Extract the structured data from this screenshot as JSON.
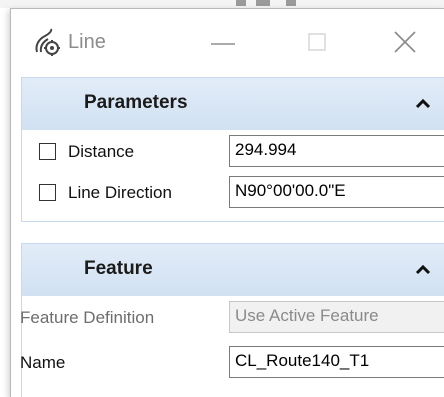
{
  "window": {
    "title": "Line",
    "icon": "line-tool-icon"
  },
  "parameters": {
    "header": "Parameters",
    "distance": {
      "label": "Distance",
      "value": "294.994",
      "checked": false
    },
    "line_direction": {
      "label": "Line Direction",
      "value": "N90°00'00.0\"E",
      "checked": false
    }
  },
  "feature": {
    "header": "Feature",
    "feature_definition": {
      "label": "Feature Definition",
      "value": "Use Active Feature"
    },
    "name": {
      "label": "Name",
      "value": "CL_Route140_T1"
    }
  },
  "colors": {
    "section_header": "#d1e1f2",
    "disabled_text": "#8a8a8a"
  }
}
